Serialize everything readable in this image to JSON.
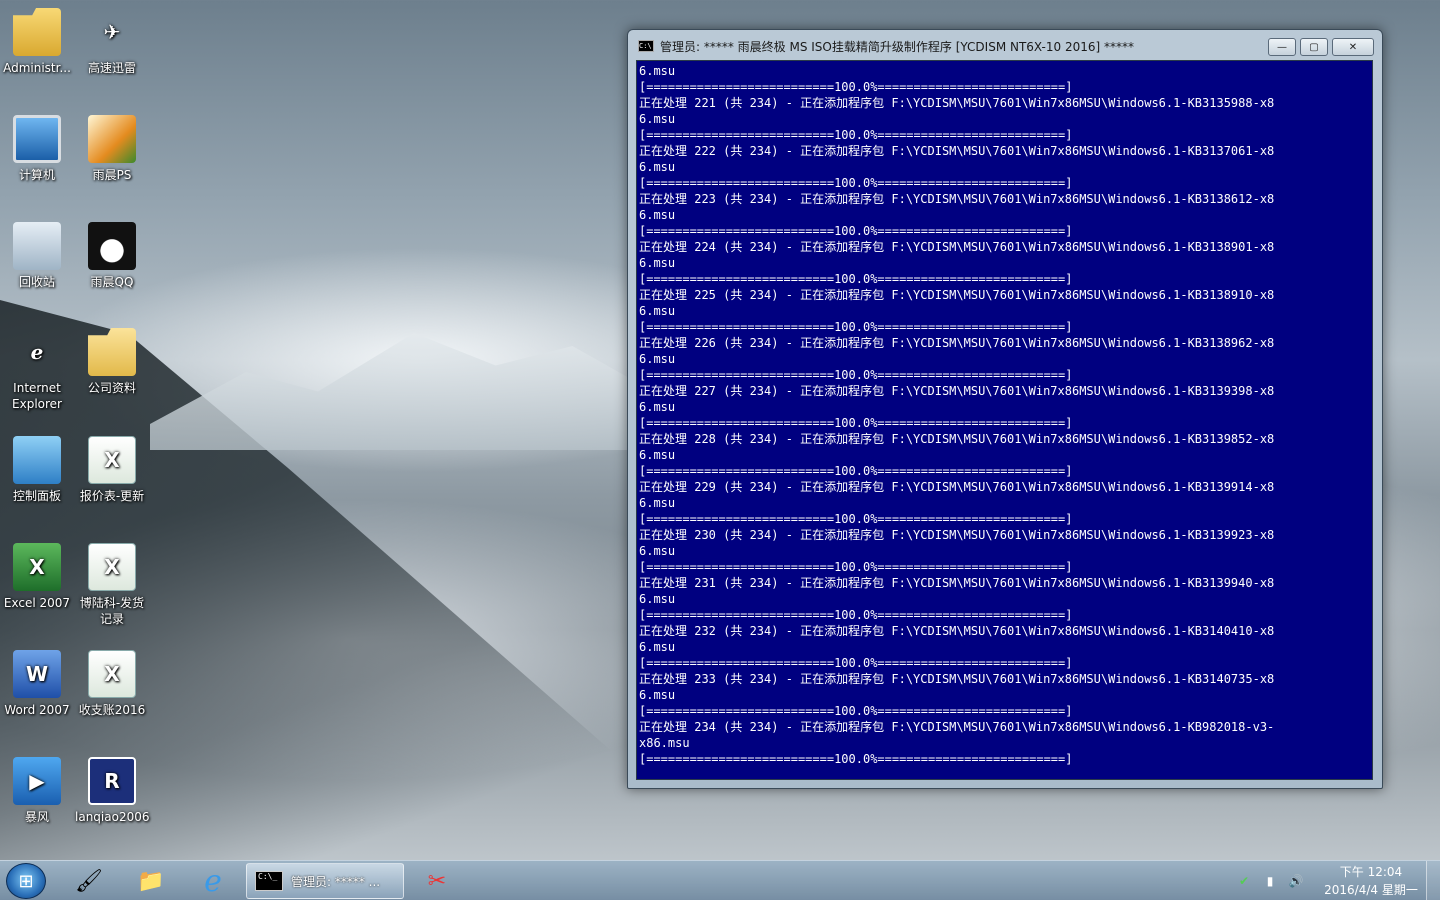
{
  "desktop": {
    "icons": [
      {
        "label": "Administr...",
        "icon": "user-folder-icon"
      },
      {
        "label": "高速迅雷",
        "icon": "thunder-bird-icon"
      },
      {
        "label": "计算机",
        "icon": "computer-icon"
      },
      {
        "label": "雨晨PS",
        "icon": "photoshop-feather-icon"
      },
      {
        "label": "回收站",
        "icon": "recycle-bin-icon"
      },
      {
        "label": "雨晨QQ",
        "icon": "qq-penguin-icon"
      },
      {
        "label": "Internet Explorer",
        "icon": "internet-explorer-icon"
      },
      {
        "label": "公司资料",
        "icon": "folder-icon"
      },
      {
        "label": "控制面板",
        "icon": "control-panel-icon"
      },
      {
        "label": "报价表-更新",
        "icon": "excel-file-icon"
      },
      {
        "label": "Excel 2007",
        "icon": "excel-2007-icon"
      },
      {
        "label": "博陆科-发货记录",
        "icon": "excel-file-icon"
      },
      {
        "label": "Word 2007",
        "icon": "word-2007-icon"
      },
      {
        "label": "收支账2016",
        "icon": "excel-file-icon"
      },
      {
        "label": "暴风",
        "icon": "storm-player-icon"
      },
      {
        "label": "lanqiao2006",
        "icon": "lanqiao-icon"
      }
    ]
  },
  "window": {
    "title": "管理员:   ***** 雨晨终极 MS ISO挂载精简升级制作程序 [YCDISM NT6X-10 2016] *****",
    "icon_text": "C:\\",
    "buttons": {
      "minimize": "—",
      "maximize": "▢",
      "close": "✕"
    },
    "console_lines": [
      "6.msu",
      "[==========================100.0%==========================]",
      "正在处理 221 (共 234) - 正在添加程序包 F:\\YCDISM\\MSU\\7601\\Win7x86MSU\\Windows6.1-KB3135988-x8",
      "6.msu",
      "[==========================100.0%==========================]",
      "正在处理 222 (共 234) - 正在添加程序包 F:\\YCDISM\\MSU\\7601\\Win7x86MSU\\Windows6.1-KB3137061-x8",
      "6.msu",
      "[==========================100.0%==========================]",
      "正在处理 223 (共 234) - 正在添加程序包 F:\\YCDISM\\MSU\\7601\\Win7x86MSU\\Windows6.1-KB3138612-x8",
      "6.msu",
      "[==========================100.0%==========================]",
      "正在处理 224 (共 234) - 正在添加程序包 F:\\YCDISM\\MSU\\7601\\Win7x86MSU\\Windows6.1-KB3138901-x8",
      "6.msu",
      "[==========================100.0%==========================]",
      "正在处理 225 (共 234) - 正在添加程序包 F:\\YCDISM\\MSU\\7601\\Win7x86MSU\\Windows6.1-KB3138910-x8",
      "6.msu",
      "[==========================100.0%==========================]",
      "正在处理 226 (共 234) - 正在添加程序包 F:\\YCDISM\\MSU\\7601\\Win7x86MSU\\Windows6.1-KB3138962-x8",
      "6.msu",
      "[==========================100.0%==========================]",
      "正在处理 227 (共 234) - 正在添加程序包 F:\\YCDISM\\MSU\\7601\\Win7x86MSU\\Windows6.1-KB3139398-x8",
      "6.msu",
      "[==========================100.0%==========================]",
      "正在处理 228 (共 234) - 正在添加程序包 F:\\YCDISM\\MSU\\7601\\Win7x86MSU\\Windows6.1-KB3139852-x8",
      "6.msu",
      "[==========================100.0%==========================]",
      "正在处理 229 (共 234) - 正在添加程序包 F:\\YCDISM\\MSU\\7601\\Win7x86MSU\\Windows6.1-KB3139914-x8",
      "6.msu",
      "[==========================100.0%==========================]",
      "正在处理 230 (共 234) - 正在添加程序包 F:\\YCDISM\\MSU\\7601\\Win7x86MSU\\Windows6.1-KB3139923-x8",
      "6.msu",
      "[==========================100.0%==========================]",
      "正在处理 231 (共 234) - 正在添加程序包 F:\\YCDISM\\MSU\\7601\\Win7x86MSU\\Windows6.1-KB3139940-x8",
      "6.msu",
      "[==========================100.0%==========================]",
      "正在处理 232 (共 234) - 正在添加程序包 F:\\YCDISM\\MSU\\7601\\Win7x86MSU\\Windows6.1-KB3140410-x8",
      "6.msu",
      "[==========================100.0%==========================]",
      "正在处理 233 (共 234) - 正在添加程序包 F:\\YCDISM\\MSU\\7601\\Win7x86MSU\\Windows6.1-KB3140735-x8",
      "6.msu",
      "[==========================100.0%==========================]",
      "正在处理 234 (共 234) - 正在添加程序包 F:\\YCDISM\\MSU\\7601\\Win7x86MSU\\Windows6.1-KB982018-v3-",
      "x86.msu",
      "[==========================100.0%==========================]"
    ],
    "console_bg": "#000080",
    "console_fg": "#FFFFFF"
  },
  "taskbar": {
    "start_icon": "windows-logo-icon",
    "pinned": [
      {
        "icon": "cleaner-brush-icon",
        "glyph": "🖌"
      },
      {
        "icon": "file-explorer-icon",
        "glyph": "📁"
      },
      {
        "icon": "internet-explorer-icon",
        "glyph": "e"
      }
    ],
    "active_task_label": "管理员:   ***** ...",
    "active_task_icon_text": "C:\\_",
    "other_task": {
      "icon": "scissors-tool-icon",
      "glyph": "✂"
    },
    "tray": [
      {
        "icon": "security-shield-icon",
        "glyph": "✔"
      },
      {
        "icon": "network-icon",
        "glyph": "▮"
      },
      {
        "icon": "volume-icon",
        "glyph": "🔊"
      }
    ],
    "clock_time": "下午 12:04",
    "clock_date": "2016/4/4 星期一"
  }
}
